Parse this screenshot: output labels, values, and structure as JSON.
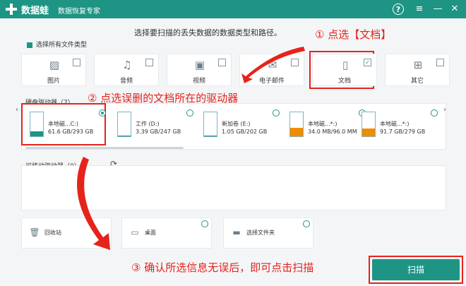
{
  "titlebar": {
    "app_name": "数据蛙",
    "subtitle": "数据恢复专家",
    "help_icon": "?",
    "menu_icon": "≡",
    "minimize_icon": "—",
    "close_icon": "✕"
  },
  "instruction": "选择要扫描的丢失数据的数据类型和路径。",
  "select_all_label": "选择所有文件类型",
  "file_types": [
    {
      "label": "图片",
      "icon": "image-icon",
      "checked": false
    },
    {
      "label": "音频",
      "icon": "audio-icon",
      "checked": false
    },
    {
      "label": "视频",
      "icon": "video-icon",
      "checked": false
    },
    {
      "label": "电子邮件",
      "icon": "email-icon",
      "checked": false
    },
    {
      "label": "文档",
      "icon": "document-icon",
      "checked": true,
      "check_mark": "✓"
    },
    {
      "label": "其它",
      "icon": "other-icon",
      "checked": false
    }
  ],
  "hard_drives": {
    "label": "硬盘驱动器（7）",
    "drives": [
      {
        "name": "本地磁...C:)",
        "size": "61.6 GB/293 GB",
        "used": 0.21,
        "color": "#1e9484",
        "selected": true
      },
      {
        "name": "工作 (D:)",
        "size": "3.39 GB/247 GB",
        "used": 0.01,
        "color": "#1e9484",
        "selected": false
      },
      {
        "name": "新加卷 (E:)",
        "size": "1.05 GB/202 GB",
        "used": 0.01,
        "color": "#1e9484",
        "selected": false
      },
      {
        "name": "本地磁...*:)",
        "size": "34.0 MB/96.0 MM",
        "used": 0.35,
        "color": "#f08c00",
        "selected": false
      },
      {
        "name": "本地磁...*:)",
        "size": "91.7 GB/279 GB",
        "used": 0.33,
        "color": "#f08c00",
        "selected": false
      }
    ]
  },
  "removable_drives": {
    "label": "可移动驱动器（0）"
  },
  "locations": [
    {
      "label": "回收站",
      "icon": "recycle-bin-icon"
    },
    {
      "label": "桌面",
      "icon": "desktop-icon"
    },
    {
      "label": "选择文件夹",
      "icon": "folder-icon"
    }
  ],
  "scan_label": "扫描",
  "callouts": {
    "step1": "① 点选【文档】",
    "step2": "② 点选误删的文档所在的驱动器",
    "step3": "③ 确认所选信息无误后，即可点击扫描"
  },
  "colors": {
    "brand": "#1e9484",
    "annotation_red": "#e5231b",
    "low_space": "#f08c00"
  }
}
